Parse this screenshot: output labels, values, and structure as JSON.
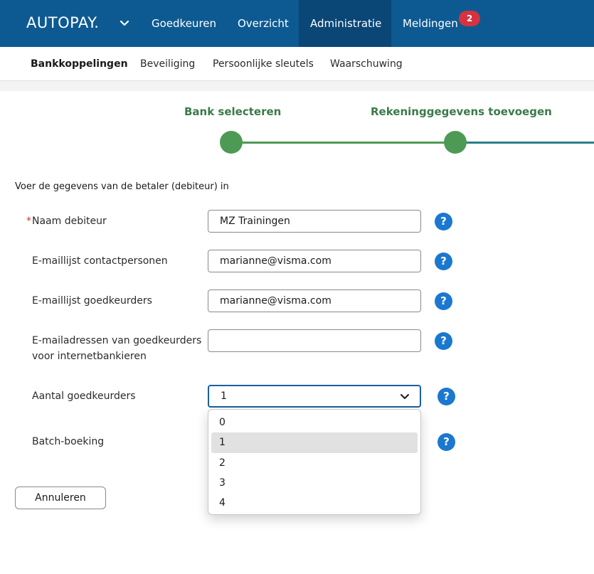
{
  "app": {
    "brand": "AUTOPAY.",
    "nav": [
      {
        "label": "Goedkeuren"
      },
      {
        "label": "Overzicht"
      },
      {
        "label": "Administratie"
      },
      {
        "label": "Meldingen"
      }
    ],
    "notifications_count": "2",
    "active_nav": "Administratie"
  },
  "subnav": {
    "items": [
      {
        "label": "Bankkoppelingen"
      },
      {
        "label": "Beveiliging"
      },
      {
        "label": "Persoonlijke sleutels"
      },
      {
        "label": "Waarschuwing"
      }
    ],
    "active": "Bankkoppelingen"
  },
  "stepper": {
    "steps": [
      {
        "label": "Bank selecteren"
      },
      {
        "label": "Rekeninggegevens toevoegen"
      }
    ]
  },
  "form": {
    "instruction": "Voer de gegevens van de betaler (debiteur) in",
    "required_mark": "*",
    "fields": [
      {
        "label": "Naam debiteur",
        "value": "MZ Trainingen"
      },
      {
        "label": "E-maillijst contactpersonen",
        "value": "marianne@visma.com"
      },
      {
        "label": "E-maillijst goedkeurders",
        "value": "marianne@visma.com"
      },
      {
        "label_line1": "E-mailadressen van goedkeurders",
        "label_line2": "voor internetbankieren",
        "value": ""
      }
    ],
    "approvers": {
      "label": "Aantal goedkeurders",
      "selected": "1",
      "options": [
        "0",
        "1",
        "2",
        "3",
        "4"
      ]
    },
    "batch": {
      "label": "Batch-boeking"
    },
    "help_glyph": "?",
    "cancel_label": "Annuleren"
  },
  "colors": {
    "topbar": "#0d5a92",
    "topbar_active": "#0a4676",
    "badge": "#d6323f",
    "step_green": "#4d9a54",
    "step_text": "#3a7a4a",
    "help_blue": "#1b78cf",
    "select_border": "#1a5fa0"
  },
  "icons": {
    "brand_menu": "chevron-down-icon",
    "select_open": "chevron-down-icon",
    "help": "help-icon"
  }
}
